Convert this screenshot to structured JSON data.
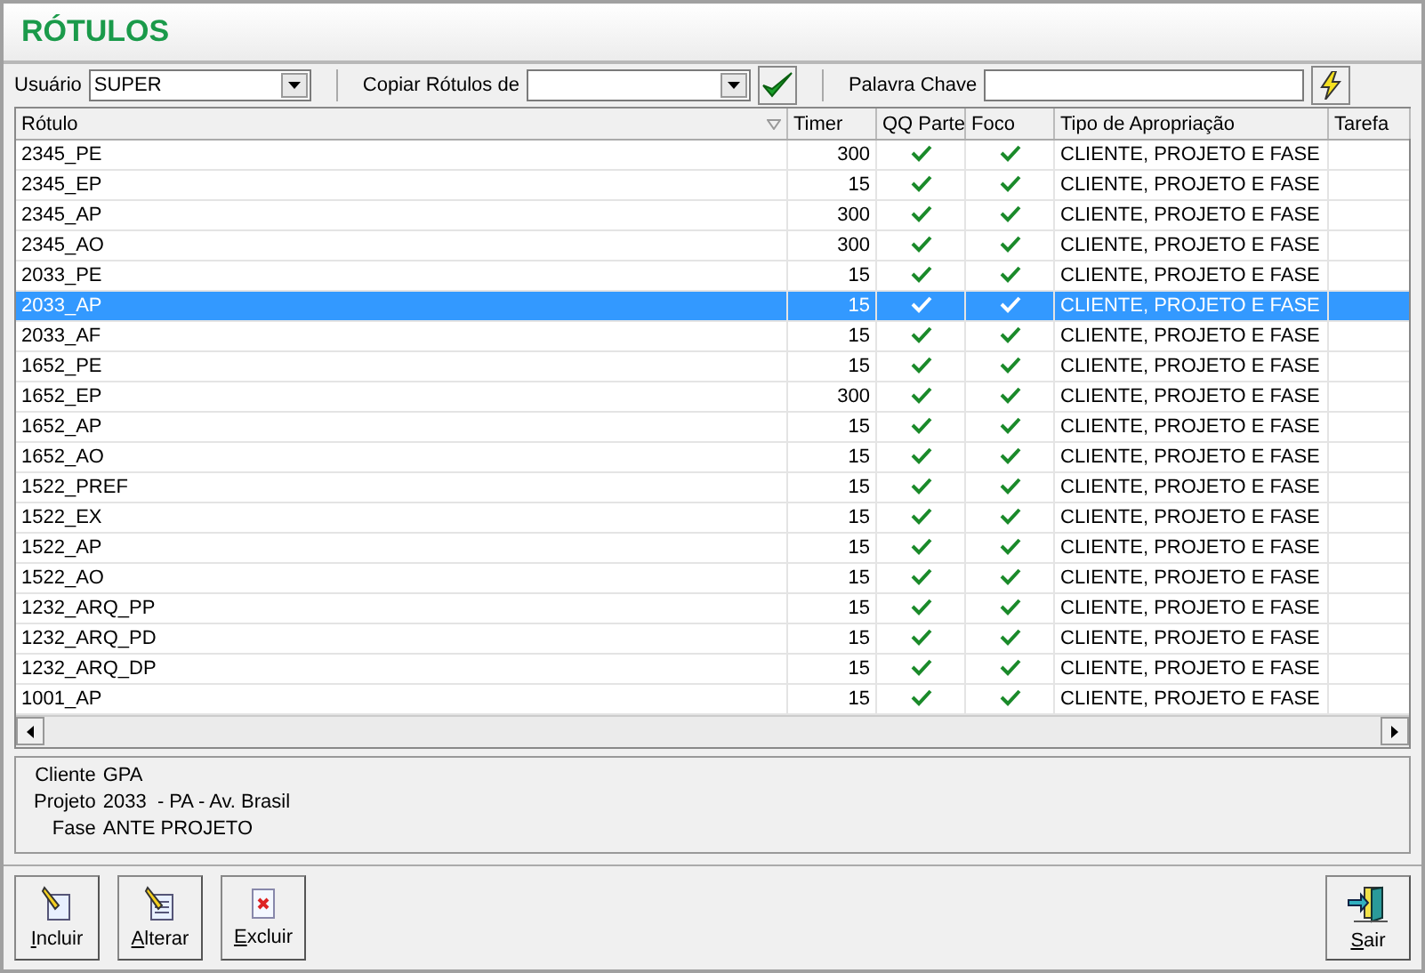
{
  "window": {
    "title": "RÓTULOS"
  },
  "toolbar": {
    "user_label": "Usuário",
    "user_value": "SUPER",
    "copy_label": "Copiar Rótulos de",
    "keyword_label": "Palavra Chave"
  },
  "table": {
    "columns": [
      "Rótulo",
      "Timer",
      "QQ Parte",
      "Foco",
      "Tipo de Apropriação",
      "Tarefa"
    ],
    "rows": [
      {
        "label": "2345_PE",
        "timer": "300",
        "qq_parte": true,
        "foco": true,
        "tipo": "CLIENTE, PROJETO E FASE",
        "selected": false
      },
      {
        "label": "2345_EP",
        "timer": "15",
        "qq_parte": true,
        "foco": true,
        "tipo": "CLIENTE, PROJETO E FASE",
        "selected": false
      },
      {
        "label": "2345_AP",
        "timer": "300",
        "qq_parte": true,
        "foco": true,
        "tipo": "CLIENTE, PROJETO E FASE",
        "selected": false
      },
      {
        "label": "2345_AO",
        "timer": "300",
        "qq_parte": true,
        "foco": true,
        "tipo": "CLIENTE, PROJETO E FASE",
        "selected": false
      },
      {
        "label": "2033_PE",
        "timer": "15",
        "qq_parte": true,
        "foco": true,
        "tipo": "CLIENTE, PROJETO E FASE",
        "selected": false
      },
      {
        "label": "2033_AP",
        "timer": "15",
        "qq_parte": true,
        "foco": true,
        "tipo": "CLIENTE, PROJETO E FASE",
        "selected": true
      },
      {
        "label": "2033_AF",
        "timer": "15",
        "qq_parte": true,
        "foco": true,
        "tipo": "CLIENTE, PROJETO E FASE",
        "selected": false
      },
      {
        "label": "1652_PE",
        "timer": "15",
        "qq_parte": true,
        "foco": true,
        "tipo": "CLIENTE, PROJETO E FASE",
        "selected": false
      },
      {
        "label": "1652_EP",
        "timer": "300",
        "qq_parte": true,
        "foco": true,
        "tipo": "CLIENTE, PROJETO E FASE",
        "selected": false
      },
      {
        "label": "1652_AP",
        "timer": "15",
        "qq_parte": true,
        "foco": true,
        "tipo": "CLIENTE, PROJETO E FASE",
        "selected": false
      },
      {
        "label": "1652_AO",
        "timer": "15",
        "qq_parte": true,
        "foco": true,
        "tipo": "CLIENTE, PROJETO E FASE",
        "selected": false
      },
      {
        "label": "1522_PREF",
        "timer": "15",
        "qq_parte": true,
        "foco": true,
        "tipo": "CLIENTE, PROJETO E FASE",
        "selected": false
      },
      {
        "label": "1522_EX",
        "timer": "15",
        "qq_parte": true,
        "foco": true,
        "tipo": "CLIENTE, PROJETO E FASE",
        "selected": false
      },
      {
        "label": "1522_AP",
        "timer": "15",
        "qq_parte": true,
        "foco": true,
        "tipo": "CLIENTE, PROJETO E FASE",
        "selected": false
      },
      {
        "label": "1522_AO",
        "timer": "15",
        "qq_parte": true,
        "foco": true,
        "tipo": "CLIENTE, PROJETO E FASE",
        "selected": false
      },
      {
        "label": "1232_ARQ_PP",
        "timer": "15",
        "qq_parte": true,
        "foco": true,
        "tipo": "CLIENTE, PROJETO E FASE",
        "selected": false
      },
      {
        "label": "1232_ARQ_PD",
        "timer": "15",
        "qq_parte": true,
        "foco": true,
        "tipo": "CLIENTE, PROJETO E FASE",
        "selected": false
      },
      {
        "label": "1232_ARQ_DP",
        "timer": "15",
        "qq_parte": true,
        "foco": true,
        "tipo": "CLIENTE, PROJETO E FASE",
        "selected": false
      },
      {
        "label": "1001_AP",
        "timer": "15",
        "qq_parte": true,
        "foco": true,
        "tipo": "CLIENTE, PROJETO E FASE",
        "selected": false
      }
    ]
  },
  "details": [
    {
      "label": "Cliente",
      "value": "GPA"
    },
    {
      "label": "Projeto",
      "value": "2033  - PA - Av. Brasil"
    },
    {
      "label": "Fase",
      "value": "ANTE PROJETO"
    }
  ],
  "buttons": [
    {
      "kind": "add",
      "label": "Incluir"
    },
    {
      "kind": "edit",
      "label": "Alterar"
    },
    {
      "kind": "delete",
      "label": "Excluir"
    },
    {
      "kind": "exit",
      "label": "Sair"
    }
  ]
}
